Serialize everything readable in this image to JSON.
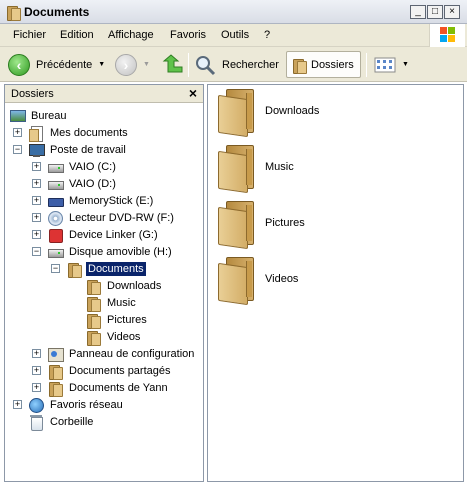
{
  "window": {
    "title": "Documents"
  },
  "menu": [
    "Fichier",
    "Edition",
    "Affichage",
    "Favoris",
    "Outils",
    "?"
  ],
  "toolbar": {
    "back_label": "Précédente",
    "search_label": "Rechercher",
    "folders_label": "Dossiers"
  },
  "left_pane": {
    "title": "Dossiers",
    "tree": [
      {
        "label": "Bureau",
        "icon": "desktop-icon"
      },
      {
        "label": "Mes documents",
        "icon": "my-documents-icon",
        "expander": "+"
      },
      {
        "label": "Poste de travail",
        "icon": "computer-icon",
        "expander": "−"
      },
      {
        "label": "VAIO (C:)",
        "icon": "drive-icon",
        "expander": "+"
      },
      {
        "label": "VAIO (D:)",
        "icon": "drive-icon",
        "expander": "+"
      },
      {
        "label": "MemoryStick (E:)",
        "icon": "memory-stick-icon",
        "expander": "+"
      },
      {
        "label": "Lecteur DVD-RW (F:)",
        "icon": "dvd-icon",
        "expander": "+"
      },
      {
        "label": "Device Linker (G:)",
        "icon": "device-icon",
        "expander": "+"
      },
      {
        "label": "Disque amovible (H:)",
        "icon": "removable-disk-icon",
        "expander": "−"
      },
      {
        "label": "Documents",
        "icon": "folder-icon",
        "expander": "−",
        "selected": true
      },
      {
        "label": "Downloads",
        "icon": "folder-icon"
      },
      {
        "label": "Music",
        "icon": "folder-icon"
      },
      {
        "label": "Pictures",
        "icon": "folder-icon"
      },
      {
        "label": "Videos",
        "icon": "folder-icon"
      },
      {
        "label": "Panneau de configuration",
        "icon": "control-panel-icon",
        "expander": "+"
      },
      {
        "label": "Documents partagés",
        "icon": "folder-icon",
        "expander": "+"
      },
      {
        "label": "Documents de Yann",
        "icon": "folder-icon",
        "expander": "+"
      },
      {
        "label": "Favoris réseau",
        "icon": "network-icon",
        "expander": "+"
      },
      {
        "label": "Corbeille",
        "icon": "recycle-bin-icon"
      }
    ]
  },
  "content": {
    "items": [
      "Downloads",
      "Music",
      "Pictures",
      "Videos"
    ]
  }
}
